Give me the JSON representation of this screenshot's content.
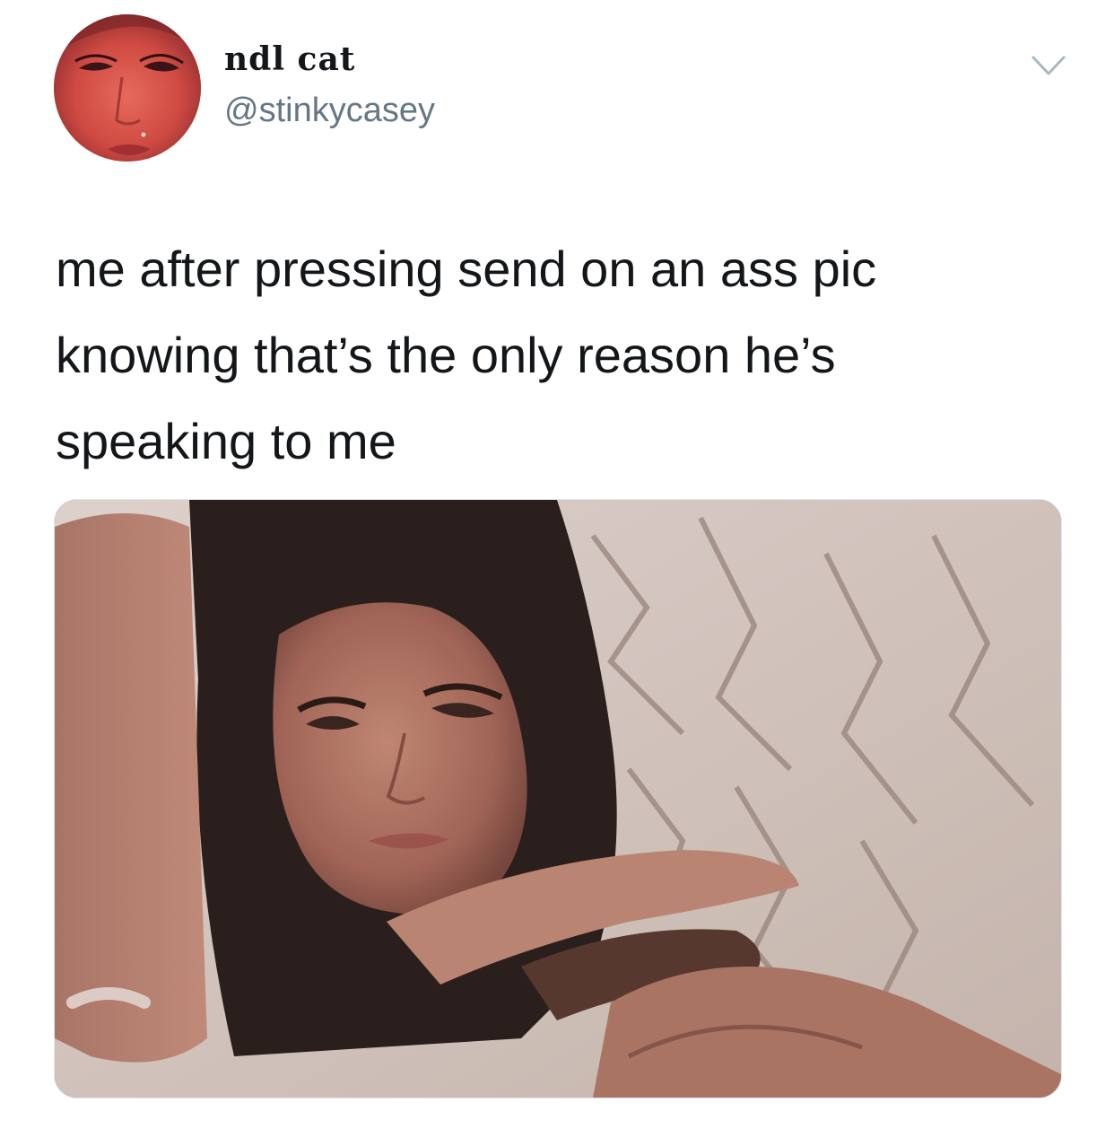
{
  "tweet": {
    "author": {
      "display_name": "ndl cat",
      "handle": "@stinkycasey",
      "avatar_icon": "profile-photo"
    },
    "menu_icon": "chevron-down-icon",
    "text": "me after pressing send on an ass pic\nknowing that’s the only reason he’s\nspeaking to me",
    "media_icon": "attached-photo"
  },
  "colors": {
    "primary_text": "#14171a",
    "secondary_text": "#657786",
    "chevron": "#aab8c2",
    "background": "#ffffff"
  }
}
